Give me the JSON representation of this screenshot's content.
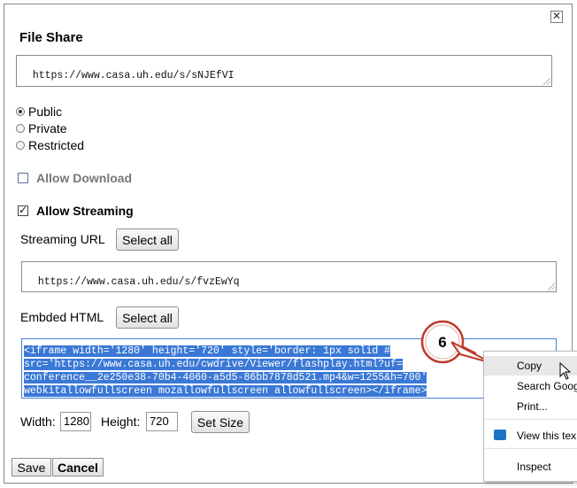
{
  "dialog": {
    "close_glyph": "✕",
    "title": "File Share",
    "share_url": "https://www.casa.uh.edu/s/sNJEfVI"
  },
  "access": {
    "options": [
      {
        "label": "Public",
        "checked": true
      },
      {
        "label": "Private",
        "checked": false
      },
      {
        "label": "Restricted",
        "checked": false
      }
    ]
  },
  "download": {
    "label": "Allow Download",
    "checked": false
  },
  "streaming": {
    "label": "Allow Streaming",
    "checked": true,
    "url_label": "Streaming URL",
    "select_all": "Select all",
    "url": "https://www.casa.uh.edu/s/fvzEwYq"
  },
  "embed": {
    "label": "Embded HTML",
    "select_all": "Select all",
    "lines": [
      "<iframe width='1280' height='720' style='border: 1px solid #",
      "src='https://www.casa.uh.edu/cwdrive/Viewer/flashplay.html?uf=",
      "conference__2e250e38-70b4-4060-a5d5-86bb7878d521.mp4&w=1255&h=700'",
      "webkitallowfullscreen mozallowfullscreen allowfullscreen></iframe>"
    ]
  },
  "size": {
    "width_label": "Width:",
    "width_value": "1280",
    "height_label": "Height:",
    "height_value": "720",
    "set_size": "Set Size"
  },
  "footer": {
    "save": "Save",
    "cancel": "Cancel"
  },
  "context_menu": {
    "items": [
      "Copy",
      "Search Goog",
      "Print...",
      "View this tex",
      "Inspect"
    ],
    "hovered": "Copy"
  },
  "callout": {
    "number": "6",
    "colors": {
      "ring": "#c0392b",
      "fill": "#ffffff"
    }
  },
  "colors": {
    "selection": "#3a78d6",
    "focus_border": "#4a7fd8"
  }
}
